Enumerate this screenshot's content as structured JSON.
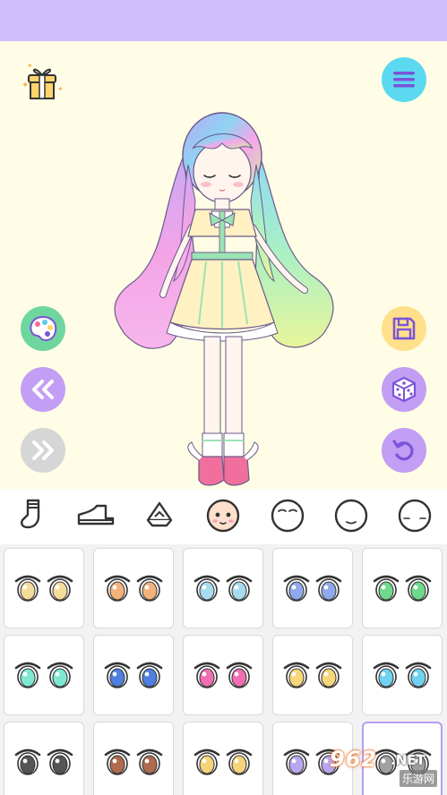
{
  "colors": {
    "top_bar": "#cdbdfa",
    "stage_background": "#fffde6",
    "menu_button": "#5cd8f0",
    "palette_button": "#6fd69f",
    "nav_button": "#c39ef5",
    "nav_button_disabled": "#d6d6d6",
    "save_button": "#ffe08a",
    "random_button": "#c39ef5",
    "undo_button": "#c39ef5",
    "selected_cell_border": "#b79cf2"
  },
  "toolbar_left": {
    "buttons": [
      {
        "icon": "palette-icon"
      },
      {
        "icon": "double-chevron-left-icon"
      },
      {
        "icon": "double-chevron-right-icon",
        "state": "disabled"
      }
    ]
  },
  "toolbar_right": {
    "buttons": [
      {
        "icon": "menu-icon"
      },
      {
        "icon": "save-icon"
      },
      {
        "icon": "dice-icon"
      },
      {
        "icon": "undo-icon"
      }
    ]
  },
  "categories": {
    "items": [
      {
        "icon": "sock-icon"
      },
      {
        "icon": "shoe-icon"
      },
      {
        "icon": "bag-icon"
      },
      {
        "icon": "face-icon",
        "selected": true
      },
      {
        "icon": "face-outline-icon"
      },
      {
        "icon": "face-outline-icon"
      },
      {
        "icon": "face-outline-icon"
      }
    ]
  },
  "eye_options": {
    "selected_index": 14,
    "items": [
      {
        "iris": "#f4dc9a"
      },
      {
        "iris": "#f2b27a"
      },
      {
        "iris": "#a7dcf0"
      },
      {
        "iris": "#8fa8ee"
      },
      {
        "iris": "#6fd98c"
      },
      {
        "iris": "#7ee8d2"
      },
      {
        "iris": "#4f7fe0"
      },
      {
        "iris": "#f06fb3"
      },
      {
        "iris": "#f7d77a"
      },
      {
        "iris": "#6fd2f0"
      },
      {
        "iris": "#555555"
      },
      {
        "iris": "#b06a4e"
      },
      {
        "iris": "#f4d37a"
      },
      {
        "iris": "#b9a6f0"
      },
      {
        "iris": "#a0a0a0"
      }
    ]
  },
  "watermark": {
    "number": "962",
    "domain": ".NET",
    "site_name": "乐游网"
  }
}
